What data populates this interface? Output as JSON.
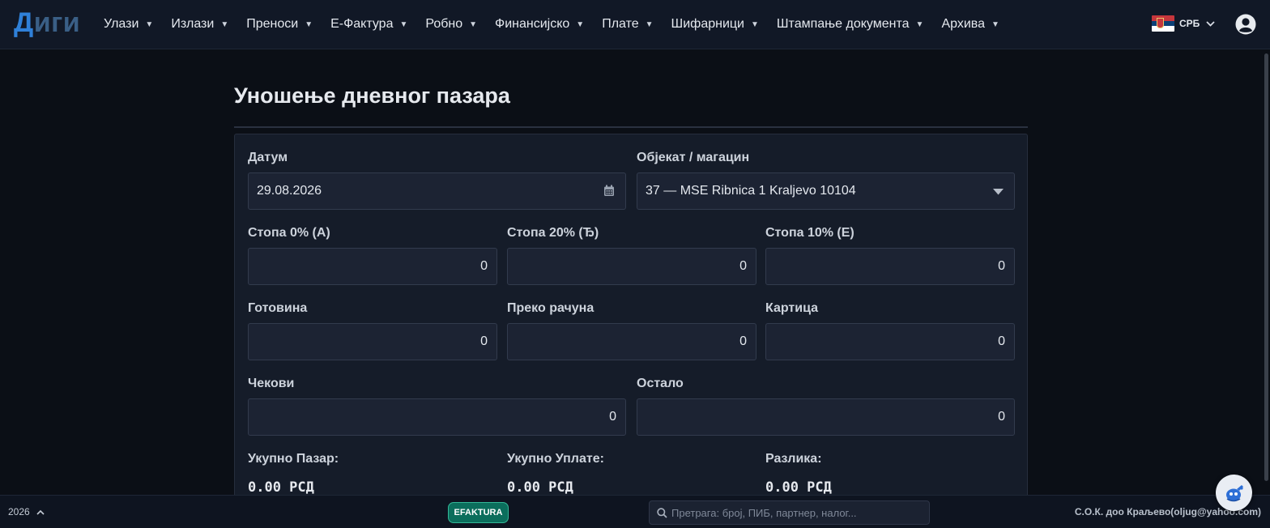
{
  "app": {
    "logo_part1": "Д",
    "logo_part2": "иги"
  },
  "nav": {
    "items": [
      {
        "label": "Улази"
      },
      {
        "label": "Излази"
      },
      {
        "label": "Преноси"
      },
      {
        "label": "Е-Фактура"
      },
      {
        "label": "Робно"
      },
      {
        "label": "Финансијско"
      },
      {
        "label": "Плате"
      },
      {
        "label": "Шифарници"
      },
      {
        "label": "Штампање документа"
      },
      {
        "label": "Архива"
      }
    ],
    "language": "СРБ",
    "user_icon": "user-circle-icon"
  },
  "page": {
    "title": "Уношење дневног пазара"
  },
  "form": {
    "date_label": "Датум",
    "date_value": "29.08.2026",
    "object_label": "Објекат / магацин",
    "object_value": "37 — MSE Ribnica 1 Kraljevo 10104",
    "rate0_label": "Стопа 0% (А)",
    "rate0_value": "0",
    "rate20_label": "Стопа 20% (Ђ)",
    "rate20_value": "0",
    "rate10_label": "Стопа 10% (Е)",
    "rate10_value": "0",
    "cash_label": "Готовина",
    "cash_value": "0",
    "transfer_label": "Преко рачуна",
    "transfer_value": "0",
    "card_label": "Картица",
    "card_value": "0",
    "checks_label": "Чекови",
    "checks_value": "0",
    "other_label": "Остало",
    "other_value": "0",
    "total_sales_label": "Укупно Пазар:",
    "total_sales_value": "0.00 РСД",
    "total_payments_label": "Укупно Уплате:",
    "total_payments_value": "0.00 РСД",
    "difference_label": "Разлика:",
    "difference_value": "0.00 РСД"
  },
  "footer": {
    "year": "2026",
    "efaktura_label": "EFAKTURA",
    "search_placeholder": "Претрага: број, ПИБ, партнер, налог...",
    "company": "С.О.К. доо Краљево(oljug@yahoo.com)"
  },
  "colors": {
    "background": "#0b0f16",
    "navbar": "#111826",
    "card": "#151c29",
    "input": "#1c2333",
    "accent": "#2f80d8",
    "efaktura": "#0b6e5c"
  }
}
